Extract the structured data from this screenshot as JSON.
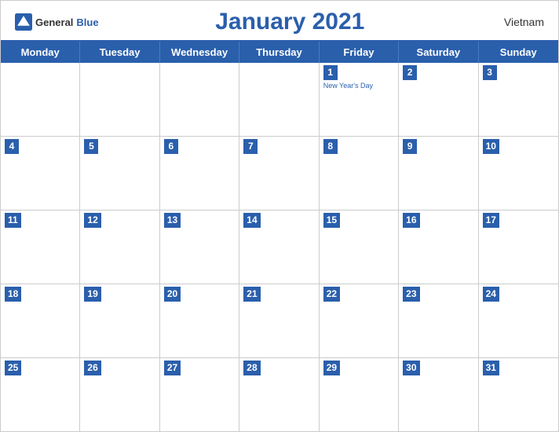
{
  "header": {
    "logo_general": "General",
    "logo_blue": "Blue",
    "month_title": "January 2021",
    "country": "Vietnam"
  },
  "day_headers": [
    "Monday",
    "Tuesday",
    "Wednesday",
    "Thursday",
    "Friday",
    "Saturday",
    "Sunday"
  ],
  "weeks": [
    [
      {
        "number": "",
        "holiday": ""
      },
      {
        "number": "",
        "holiday": ""
      },
      {
        "number": "",
        "holiday": ""
      },
      {
        "number": "",
        "holiday": ""
      },
      {
        "number": "1",
        "holiday": "New Year's Day"
      },
      {
        "number": "2",
        "holiday": ""
      },
      {
        "number": "3",
        "holiday": ""
      }
    ],
    [
      {
        "number": "4",
        "holiday": ""
      },
      {
        "number": "5",
        "holiday": ""
      },
      {
        "number": "6",
        "holiday": ""
      },
      {
        "number": "7",
        "holiday": ""
      },
      {
        "number": "8",
        "holiday": ""
      },
      {
        "number": "9",
        "holiday": ""
      },
      {
        "number": "10",
        "holiday": ""
      }
    ],
    [
      {
        "number": "11",
        "holiday": ""
      },
      {
        "number": "12",
        "holiday": ""
      },
      {
        "number": "13",
        "holiday": ""
      },
      {
        "number": "14",
        "holiday": ""
      },
      {
        "number": "15",
        "holiday": ""
      },
      {
        "number": "16",
        "holiday": ""
      },
      {
        "number": "17",
        "holiday": ""
      }
    ],
    [
      {
        "number": "18",
        "holiday": ""
      },
      {
        "number": "19",
        "holiday": ""
      },
      {
        "number": "20",
        "holiday": ""
      },
      {
        "number": "21",
        "holiday": ""
      },
      {
        "number": "22",
        "holiday": ""
      },
      {
        "number": "23",
        "holiday": ""
      },
      {
        "number": "24",
        "holiday": ""
      }
    ],
    [
      {
        "number": "25",
        "holiday": ""
      },
      {
        "number": "26",
        "holiday": ""
      },
      {
        "number": "27",
        "holiday": ""
      },
      {
        "number": "28",
        "holiday": ""
      },
      {
        "number": "29",
        "holiday": ""
      },
      {
        "number": "30",
        "holiday": ""
      },
      {
        "number": "31",
        "holiday": ""
      }
    ]
  ]
}
